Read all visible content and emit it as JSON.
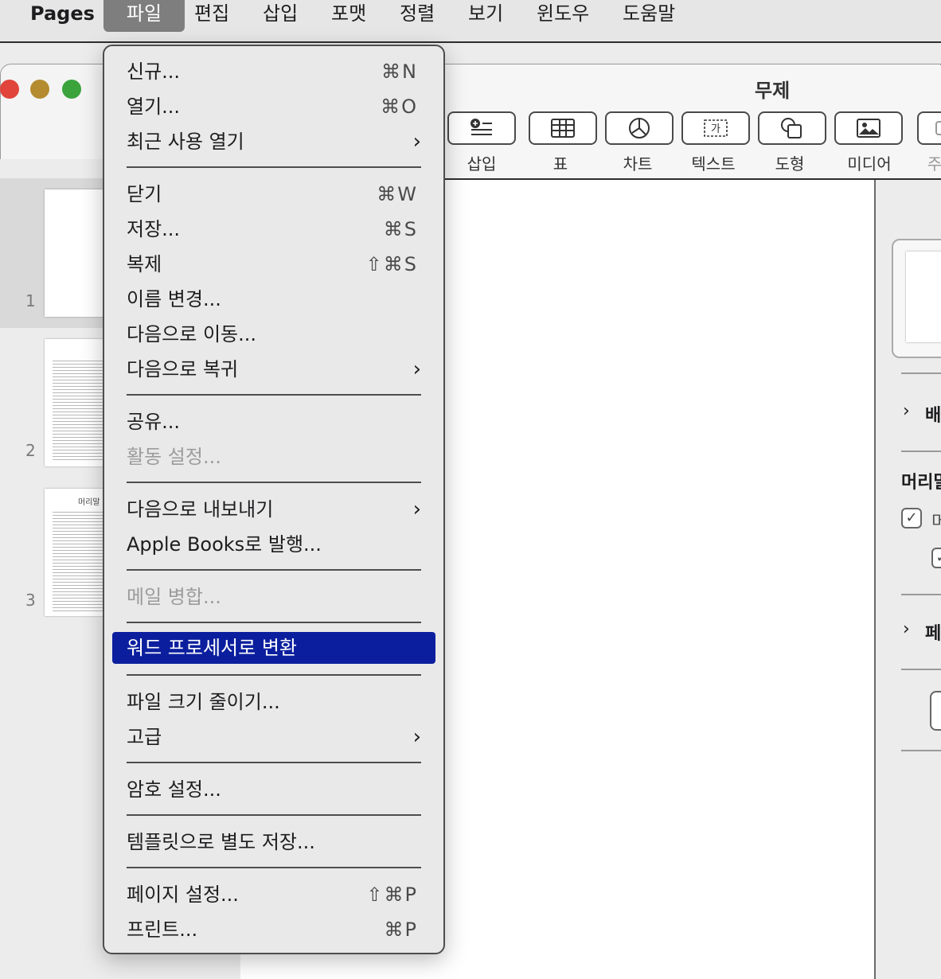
{
  "menubar": {
    "app": "Pages",
    "items": [
      "파일",
      "편집",
      "삽입",
      "포맷",
      "정렬",
      "보기",
      "윈도우",
      "도움말"
    ]
  },
  "document": {
    "title": "무제"
  },
  "toolbar": {
    "buttons": [
      {
        "label": "삽입",
        "icon": "insert-list-icon"
      },
      {
        "label": "표",
        "icon": "table-icon"
      },
      {
        "label": "차트",
        "icon": "chart-icon"
      },
      {
        "label": "텍스트",
        "icon": "textbox-icon"
      },
      {
        "label": "도형",
        "icon": "shape-icon"
      },
      {
        "label": "미디어",
        "icon": "media-icon"
      },
      {
        "label": "주",
        "icon": "comment-icon"
      }
    ]
  },
  "sidebar": {
    "pages": [
      {
        "number": "1"
      },
      {
        "number": "2"
      },
      {
        "number": "3",
        "header": "머리말"
      }
    ]
  },
  "inspector": {
    "section1": "배",
    "header_label": "머리말",
    "checkbox1_label": "머",
    "section2": "페"
  },
  "file_menu": {
    "items": [
      {
        "label": "신규...",
        "shortcut": "⌘N"
      },
      {
        "label": "열기...",
        "shortcut": "⌘O"
      },
      {
        "label": "최근 사용 열기",
        "submenu": true
      },
      {
        "label": "닫기",
        "shortcut": "⌘W"
      },
      {
        "label": "저장...",
        "shortcut": "⌘S"
      },
      {
        "label": "복제",
        "shortcut": "⇧⌘S"
      },
      {
        "label": "이름 변경..."
      },
      {
        "label": "다음으로 이동..."
      },
      {
        "label": "다음으로 복귀",
        "submenu": true
      },
      {
        "label": "공유..."
      },
      {
        "label": "활동 설정...",
        "disabled": true
      },
      {
        "label": "다음으로 내보내기",
        "submenu": true
      },
      {
        "label": "Apple Books로 발행..."
      },
      {
        "label": "메일 병합...",
        "disabled": true
      },
      {
        "label": "워드 프로세서로 변환",
        "highlighted": true
      },
      {
        "label": "파일 크기 줄이기..."
      },
      {
        "label": "고급",
        "submenu": true
      },
      {
        "label": "암호 설정..."
      },
      {
        "label": "템플릿으로 별도 저장..."
      },
      {
        "label": "페이지 설정...",
        "shortcut": "⇧⌘P"
      },
      {
        "label": "프린트...",
        "shortcut": "⌘P"
      }
    ]
  }
}
